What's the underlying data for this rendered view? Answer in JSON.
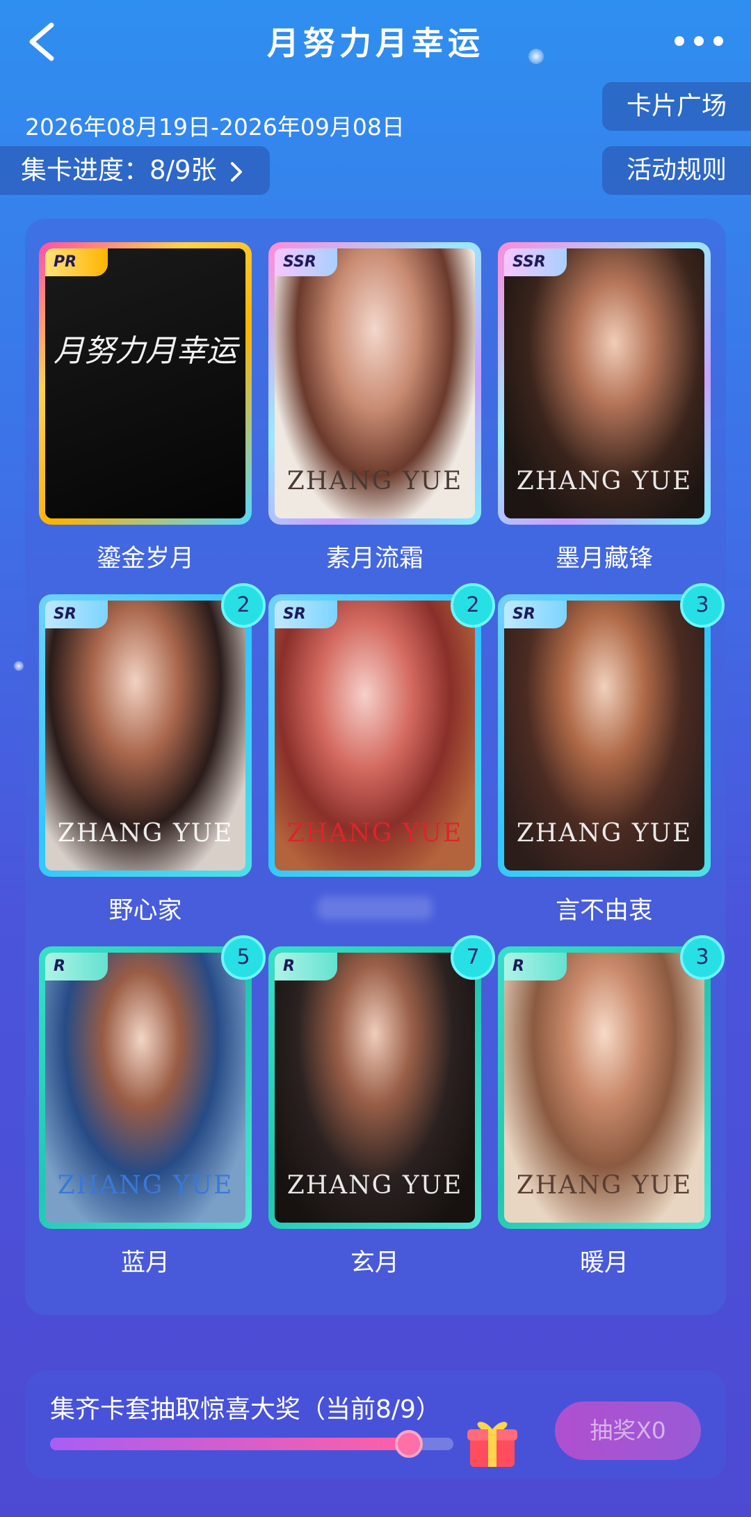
{
  "header": {
    "title": "月努力月幸运",
    "back_icon": "chevron-left-icon",
    "more_icon": "more-horizontal-icon"
  },
  "date_range": "2026年08月19日-2026年09月08日",
  "buttons": {
    "card_plaza": "卡片广场",
    "rules": "活动规则"
  },
  "progress": {
    "label": "集卡进度：8/9张",
    "chevron_icon": "chevron-right-icon"
  },
  "cards": [
    {
      "name": "鎏金岁月",
      "rarity": "PR",
      "count": "",
      "wordmark": "月努力月幸运"
    },
    {
      "name": "素月流霜",
      "rarity": "SSR",
      "count": "",
      "wordmark": "ZHANG YUE"
    },
    {
      "name": "墨月藏锋",
      "rarity": "SSR",
      "count": "",
      "wordmark": "ZHANG YUE"
    },
    {
      "name": "野心家",
      "rarity": "SR",
      "count": "2",
      "wordmark": "ZHANG YUE"
    },
    {
      "name": "",
      "rarity": "SR",
      "count": "2",
      "wordmark": "ZHANG YUE"
    },
    {
      "name": "言不由衷",
      "rarity": "SR",
      "count": "3",
      "wordmark": "ZHANG YUE"
    },
    {
      "name": "蓝月",
      "rarity": "R",
      "count": "5",
      "wordmark": "ZHANG YUE"
    },
    {
      "name": "玄月",
      "rarity": "R",
      "count": "7",
      "wordmark": "ZHANG YUE"
    },
    {
      "name": "暖月",
      "rarity": "R",
      "count": "3",
      "wordmark": "ZHANG YUE"
    }
  ],
  "reward": {
    "text": "集齐卡套抽取惊喜大奖（当前8/9）",
    "progress_fraction": 0.889,
    "gift_icon": "gift-icon",
    "draw_button": "抽奖X0"
  },
  "colors": {
    "bg_top": "#2f8ff0",
    "bg_bottom": "#4d49d3",
    "count_badge": "#27e0e6",
    "progress_fill_start": "#a85ef4",
    "progress_fill_end": "#ff5fa5"
  }
}
